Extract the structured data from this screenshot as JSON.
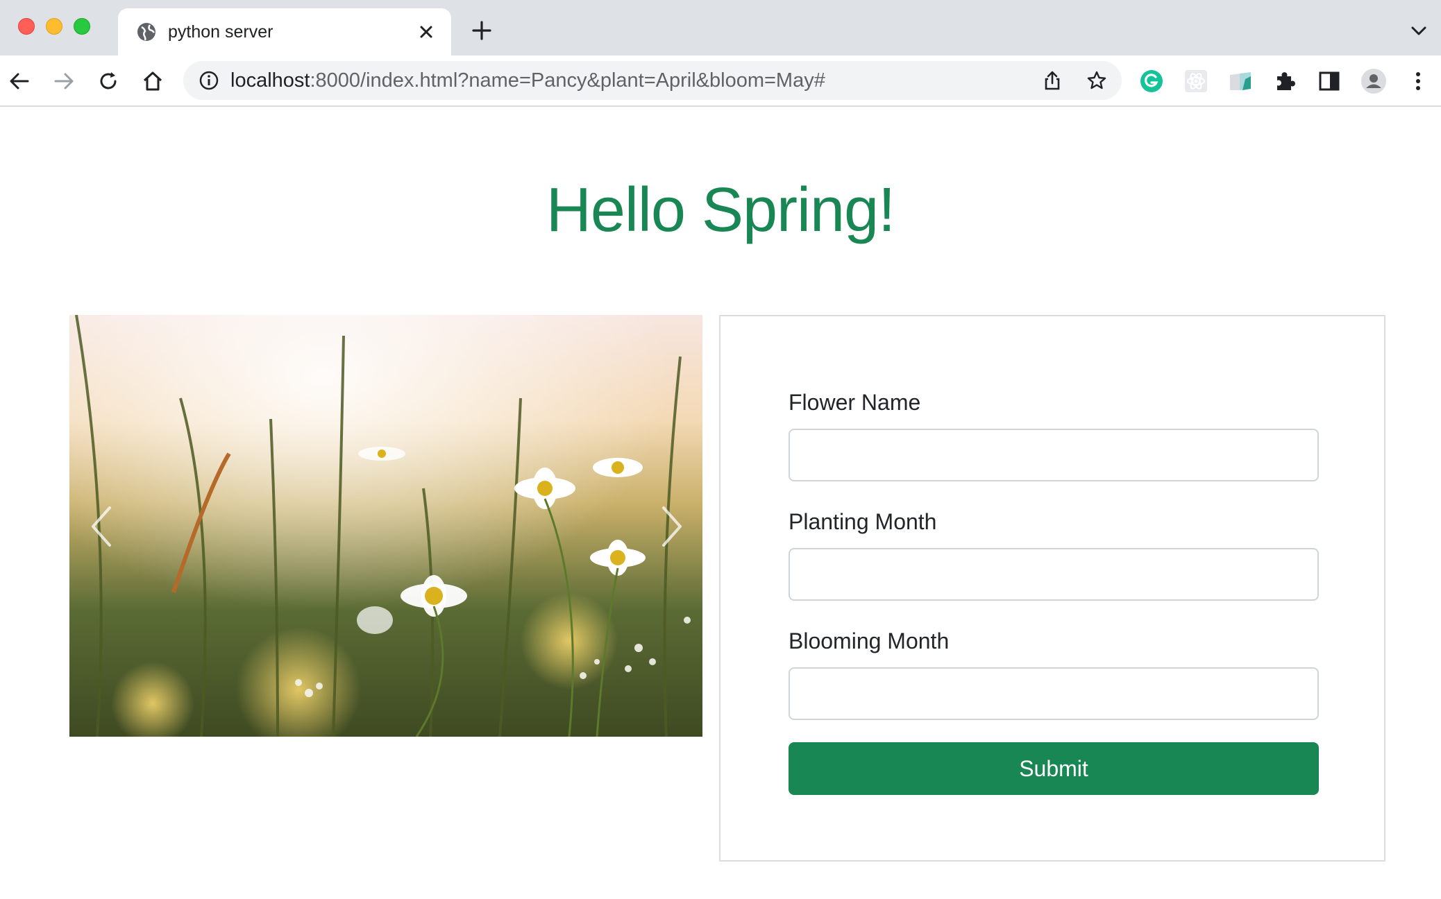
{
  "browser": {
    "tab": {
      "title": "python server",
      "favicon": "globe-icon"
    },
    "url": {
      "host": "localhost",
      "rest": ":8000/index.html?name=Pancy&plant=April&bloom=May#"
    },
    "nav_icons": [
      "back-arrow-icon",
      "forward-arrow-icon",
      "reload-icon",
      "home-icon"
    ],
    "omnibox_icons": [
      "site-info-icon",
      "share-icon",
      "bookmark-star-icon"
    ],
    "extension_icons": [
      "grammarly-icon",
      "react-devtools-icon",
      "extension-book-icon",
      "extensions-puzzle-icon",
      "side-panel-icon",
      "profile-avatar-icon",
      "more-menu-icon"
    ]
  },
  "page": {
    "heading": "Hello Spring!",
    "carousel": {
      "image": "meadow-daisies-photo",
      "prev_icon": "chevron-left-icon",
      "next_icon": "chevron-right-icon"
    },
    "form": {
      "fields": [
        {
          "label": "Flower Name",
          "value": ""
        },
        {
          "label": "Planting Month",
          "value": ""
        },
        {
          "label": "Blooming Month",
          "value": ""
        }
      ],
      "submit_label": "Submit"
    }
  },
  "colors": {
    "accent": "#198754",
    "tabbar": "#dee1e6",
    "omnibox": "#f1f3f4"
  }
}
